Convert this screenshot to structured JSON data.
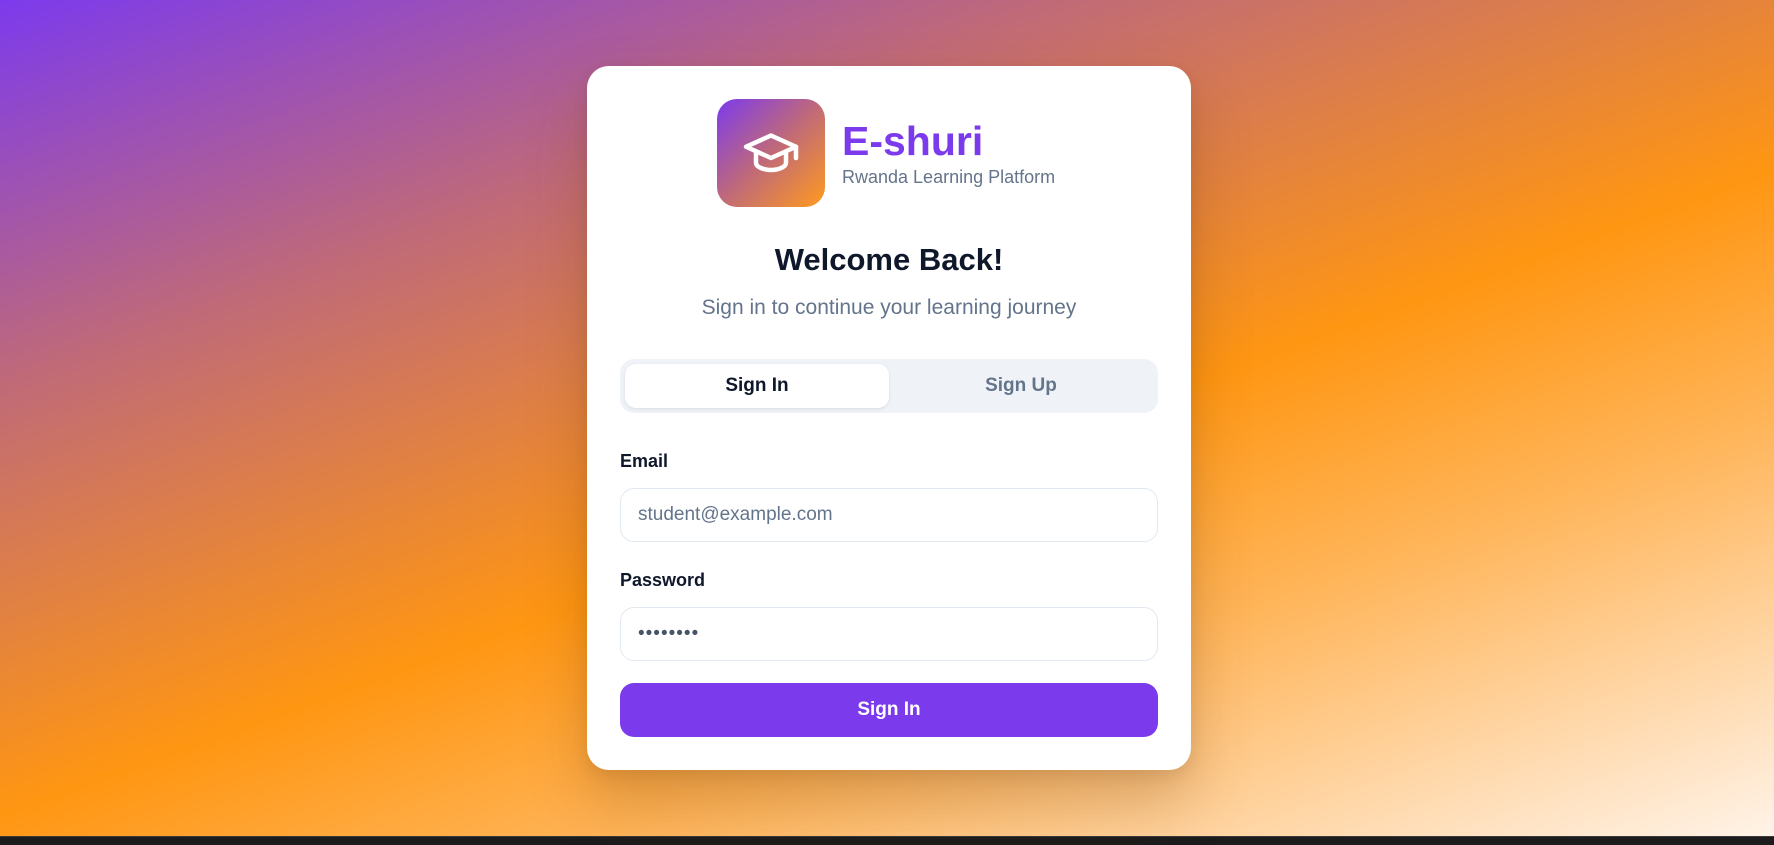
{
  "brand": {
    "name": "E-shuri",
    "tagline": "Rwanda Learning Platform",
    "logo_icon": "graduation-cap-icon"
  },
  "welcome": {
    "title": "Welcome Back!",
    "subtitle": "Sign in to continue your learning journey"
  },
  "tabs": [
    {
      "label": "Sign In",
      "active": true
    },
    {
      "label": "Sign Up",
      "active": false
    }
  ],
  "form": {
    "email": {
      "label": "Email",
      "placeholder": "student@example.com",
      "value": ""
    },
    "password": {
      "label": "Password",
      "placeholder": "••••••••",
      "value": ""
    },
    "submit_label": "Sign In"
  },
  "colors": {
    "accent": "#7c3aed",
    "gradient_start": "#7c3aed",
    "gradient_mid": "#ff9612",
    "gradient_end": "#fff3e8"
  }
}
